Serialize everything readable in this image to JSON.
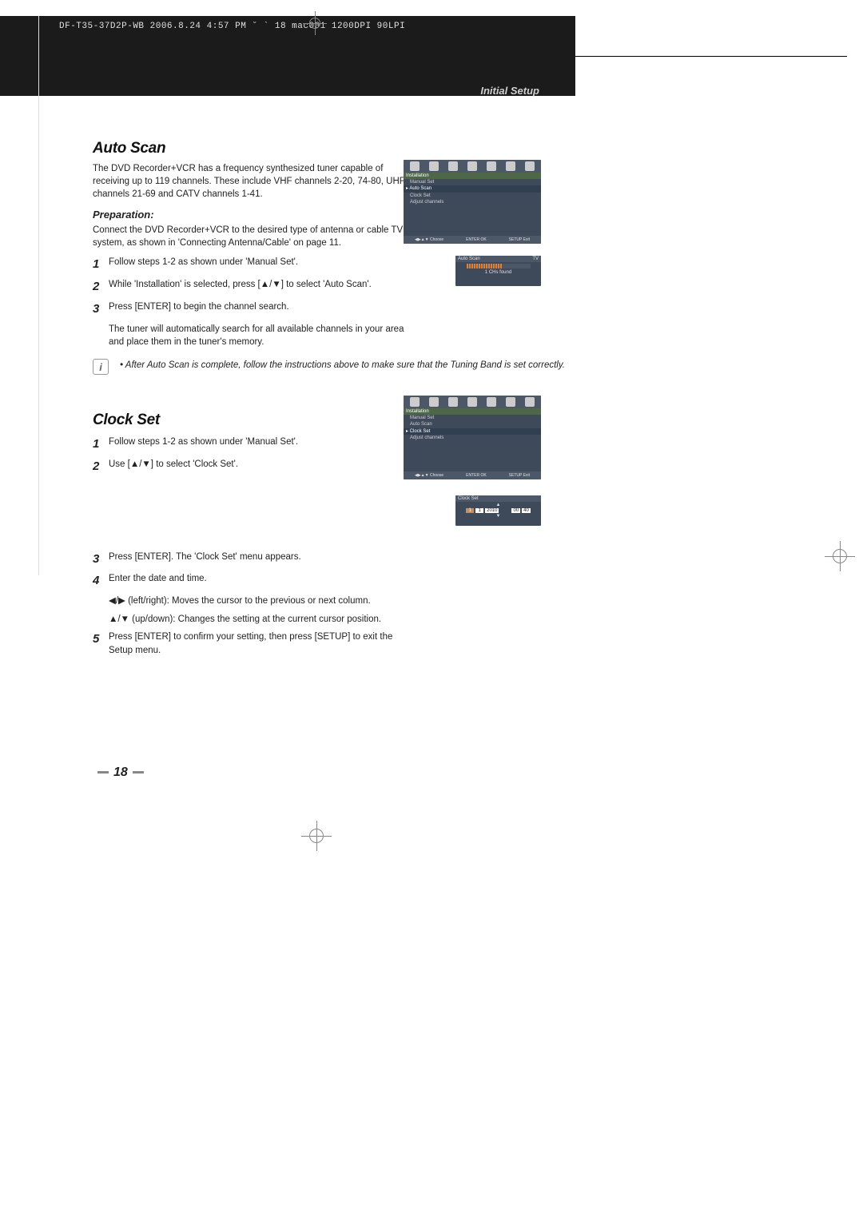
{
  "header": {
    "file_info": "DF-T35-37D2P-WB  2006.8.24 4:57 PM  ˘  ` 18   mac001  1200DPI 90LPI",
    "breadcrumb": "Initial Setup"
  },
  "section_autoscan": {
    "title": "Auto Scan",
    "intro": "The DVD Recorder+VCR has a frequency synthesized tuner capable of receiving up to 119 channels. These include VHF channels 2-20, 74-80, UHF channels 21-69 and CATV channels 1-41.",
    "prep_label": "Preparation:",
    "prep_text": "Connect the DVD Recorder+VCR to the desired type of antenna or cable TV system, as shown in 'Connecting Antenna/Cable' on page 11.",
    "steps": {
      "1": "Follow steps 1-2 as shown under 'Manual Set'.",
      "2": "While 'Installation' is selected, press [▲/▼] to select 'Auto Scan'.",
      "3": "Press [ENTER] to begin the channel search.",
      "3_extra": "The tuner will automatically search for all available channels in your area and place them in the tuner's memory."
    },
    "note": "After Auto Scan is complete, follow the instructions above to make sure that the Tuning Band is set correctly."
  },
  "section_clockset": {
    "title": "Clock Set",
    "steps": {
      "1": "Follow steps 1-2 as shown under 'Manual Set'.",
      "2": "Use [▲/▼] to select 'Clock Set'.",
      "3": "Press [ENTER]. The 'Clock Set' menu appears.",
      "4": "Enter the date and time.",
      "4_a": "◀/▶ (left/right): Moves the cursor to the previous or next column.",
      "4_b": "▲/▼ (up/down): Changes the setting at the current cursor position.",
      "5": "Press [ENTER] to confirm your setting, then press [SETUP] to exit the Setup menu."
    }
  },
  "osd_installation": {
    "section": "Installation",
    "items": [
      "Manual Set",
      "Auto Scan",
      "Clock Set",
      "Adjust channels"
    ],
    "selected_auto": "Auto Scan",
    "selected_clock": "Clock Set",
    "footer": {
      "choose": "Choose",
      "ok": "OK",
      "exit": "Exit",
      "enter": "ENTER",
      "setup": "SETUP",
      "arrows": "◀▶▲▼"
    }
  },
  "osd_autoscan_progress": {
    "title": "Auto Scan",
    "right": "TV",
    "status": "1 CHs found"
  },
  "osd_clock_fields": {
    "title": "Clock Set",
    "values": [
      "1",
      "1",
      "2010",
      "00",
      "40"
    ]
  },
  "page_number": "18"
}
